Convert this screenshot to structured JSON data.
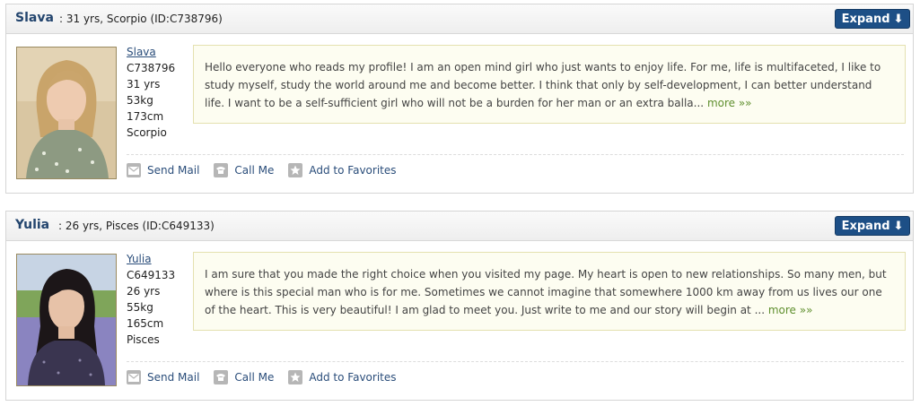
{
  "profiles": [
    {
      "name": "Slava",
      "header_info": ": 31 yrs, Scorpio (ID:C738796)",
      "expand_label": "Expand",
      "expand_icon": "arrow-down-icon",
      "link_name": "Slava",
      "id": "C738796",
      "age": "31 yrs",
      "weight": "53kg",
      "height": "173cm",
      "sign": "Scorpio",
      "bio": "Hello everyone who reads my profile! I am an open mind girl who just wants to enjoy life. For me, life is multifaceted, I like to study myself, study the world around me and become better. I think that only by self-development, I can better understand life. I want to be a self-sufficient girl who will not be a burden for her man or an extra balla...",
      "more_label": "more »»",
      "actions": {
        "send_mail": "Send Mail",
        "call_me": "Call Me",
        "add_favorites": "Add to Favorites"
      }
    },
    {
      "name": "Yulia",
      "header_info": ": 26 yrs, Pisces (ID:C649133)",
      "expand_label": "Expand",
      "expand_icon": "arrow-down-icon",
      "link_name": "Yulia",
      "id": "C649133",
      "age": "26 yrs",
      "weight": "55kg",
      "height": "165cm",
      "sign": "Pisces",
      "bio": "I am sure that you made the right choice when you visited my page. My heart is open to new relationships. So many men, but where is this special man who is for me. Sometimes we cannot imagine that somewhere 1000 km away from us lives our one of the heart. This is very beautiful! I am glad to meet you. Just write to me and our story will begin at ...",
      "more_label": "more »»",
      "actions": {
        "send_mail": "Send Mail",
        "call_me": "Call Me",
        "add_favorites": "Add to Favorites"
      }
    }
  ],
  "colors": {
    "header_name": "#23456e",
    "button": "#1d4f86",
    "more_link": "#5f8f2e",
    "bio_bg": "#fdfdf1"
  }
}
